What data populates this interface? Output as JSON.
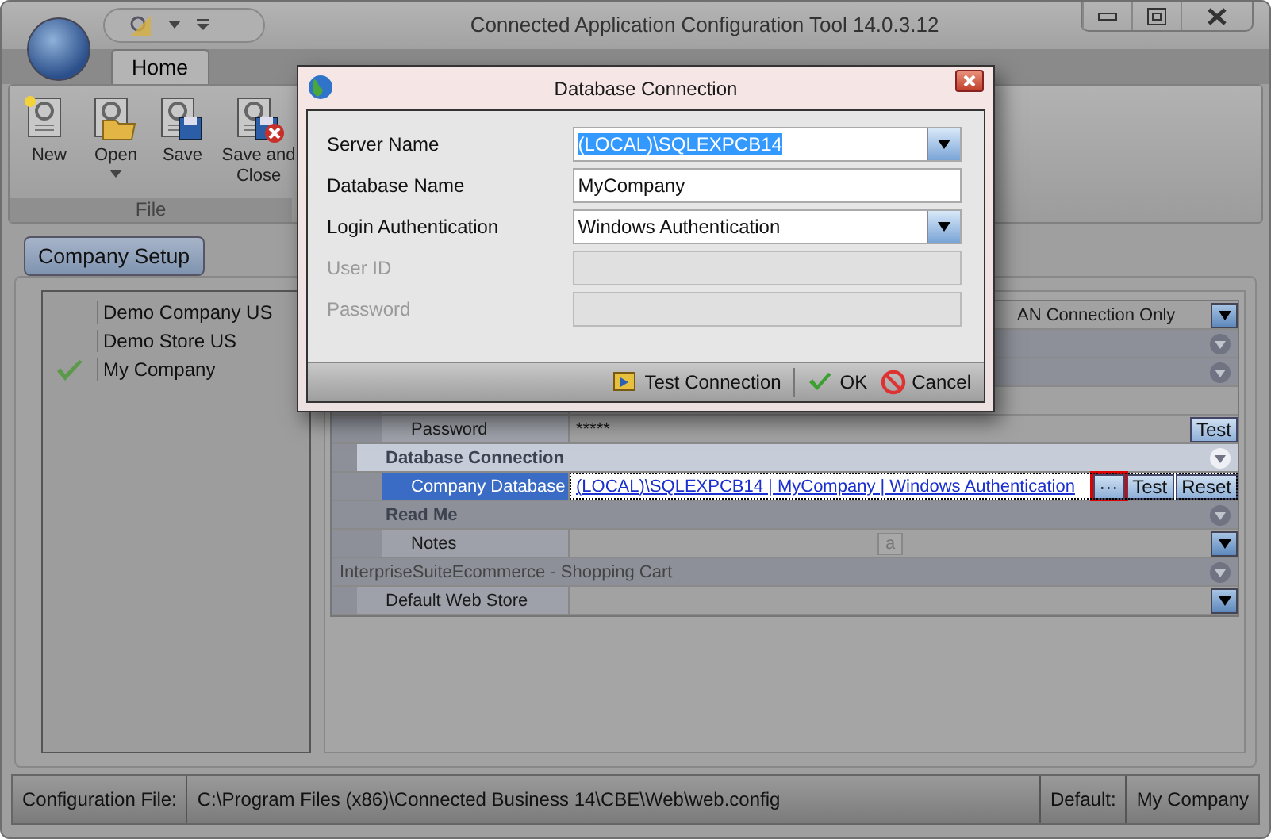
{
  "window": {
    "title": "Connected Application Configuration Tool 14.0.3.12"
  },
  "ribbon": {
    "tabs": [
      {
        "label": "Home",
        "selected": true
      }
    ],
    "buttons": [
      {
        "label": "New",
        "kind": "new",
        "dropdown": false
      },
      {
        "label": "Open",
        "kind": "open",
        "dropdown": true
      },
      {
        "label": "Save",
        "kind": "save",
        "dropdown": false
      },
      {
        "label": "Save and Close",
        "kind": "save-close",
        "dropdown": false
      }
    ],
    "group": "File"
  },
  "section_tab": {
    "label": "Company Setup",
    "selected": true
  },
  "companies": [
    {
      "name": "Demo Company US",
      "default": false
    },
    {
      "name": "Demo Store US",
      "default": false
    },
    {
      "name": "My Company",
      "default": true
    }
  ],
  "grid": {
    "groups": [
      {
        "kind": "section",
        "children": [
          {
            "kind": "property",
            "dropdown": true,
            "value": "AN Connection Only"
          },
          {
            "kind": "category",
            "expanded": true
          },
          {
            "kind": "category",
            "expanded": true,
            "children": [
              {
                "kind": "property"
              },
              {
                "kind": "property",
                "label": "Password",
                "value": "*****",
                "buttons": [
                  "Test"
                ]
              }
            ]
          },
          {
            "kind": "category",
            "label": "Database Connection",
            "expanded": true,
            "selected": true,
            "children": [
              {
                "kind": "property",
                "label": "Company Database",
                "link": "(LOCAL)\\SQLEXPCB14 | MyCompany  | Windows Authentication",
                "buttons": [
                  "···",
                  "Test",
                  "Reset"
                ],
                "selected": true
              }
            ]
          },
          {
            "kind": "category",
            "label": "Read Me",
            "expanded": true,
            "children": [
              {
                "kind": "property",
                "label": "Notes",
                "marker": "a",
                "dropdown": true
              }
            ]
          }
        ]
      },
      {
        "kind": "category",
        "label": "InterpriseSuiteEcommerce - Shopping Cart",
        "expanded": true,
        "children": [
          {
            "kind": "property",
            "label": "Default Web Store",
            "dropdown": true
          }
        ]
      }
    ]
  },
  "status_bar": {
    "config_label": "Configuration File:",
    "config_path": "C:\\Program Files (x86)\\Connected Business 14\\CBE\\Web\\web.config",
    "default_label": "Default:",
    "default_value": "My Company"
  },
  "dialog": {
    "title": "Database Connection",
    "fields": [
      {
        "label": "Server Name",
        "value": "(LOCAL)\\SQLEXPCB14",
        "kind": "combo",
        "disabled": false,
        "text_selected": true
      },
      {
        "label": "Database Name",
        "value": "MyCompany",
        "kind": "text",
        "disabled": false
      },
      {
        "label": "Login Authentication",
        "value": "Windows Authentication",
        "kind": "combo",
        "disabled": false
      },
      {
        "label": "User ID",
        "kind": "text",
        "disabled": true
      },
      {
        "label": "Password",
        "kind": "text",
        "disabled": true
      }
    ],
    "buttons": [
      {
        "label": "Test Connection",
        "kind": "test"
      },
      {
        "label": "OK",
        "kind": "ok"
      },
      {
        "label": "Cancel",
        "kind": "cancel"
      }
    ]
  }
}
